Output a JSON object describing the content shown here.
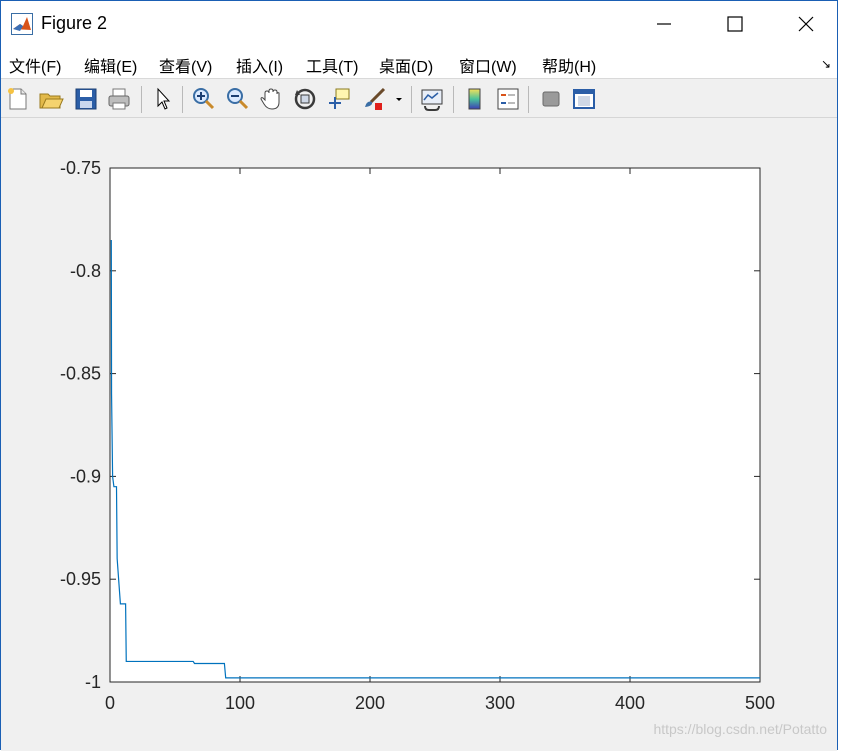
{
  "window": {
    "title": "Figure 2",
    "app_icon": "matlab-logo-icon",
    "controls": [
      "minimize-icon",
      "maximize-icon",
      "close-icon"
    ]
  },
  "menubar": {
    "items": [
      {
        "label": "文件(F)"
      },
      {
        "label": "编辑(E)"
      },
      {
        "label": "查看(V)"
      },
      {
        "label": "插入(I)"
      },
      {
        "label": "工具(T)"
      },
      {
        "label": "桌面(D)"
      },
      {
        "label": "窗口(W)"
      },
      {
        "label": "帮助(H)"
      }
    ],
    "dock_icon": "dock-arrow-icon"
  },
  "toolbar": {
    "buttons": [
      "new-figure-icon",
      "open-file-icon",
      "save-icon",
      "print-icon",
      "edit-plot-icon",
      "zoom-in-icon",
      "zoom-out-icon",
      "pan-icon",
      "rotate-3d-icon",
      "data-cursor-icon",
      "brush-icon",
      "brush-dropdown-icon",
      "link-plot-icon",
      "colorbar-icon",
      "legend-icon",
      "hide-plot-tools-icon",
      "show-plot-tools-icon"
    ]
  },
  "chart_data": {
    "type": "line",
    "title": "",
    "xlabel": "",
    "ylabel": "",
    "xlim": [
      0,
      500
    ],
    "ylim": [
      -1,
      -0.75
    ],
    "xticks": [
      0,
      100,
      200,
      300,
      400,
      500
    ],
    "xtick_labels": [
      "0",
      "100",
      "200",
      "300",
      "400",
      "500"
    ],
    "yticks": [
      -0.75,
      -0.8,
      -0.85,
      -0.9,
      -0.95,
      -1
    ],
    "ytick_labels": [
      "-0.75",
      "-0.8",
      "-0.85",
      "-0.9",
      "-0.95",
      "-1"
    ],
    "grid": false,
    "series": [
      {
        "color": "#0072bd",
        "x": [
          1,
          1.2,
          2,
          3,
          4,
          5,
          5.5,
          8,
          9,
          11,
          12,
          12.5,
          14,
          20,
          30,
          50,
          64,
          65,
          75,
          88,
          89,
          90,
          100,
          200,
          300,
          400,
          500
        ],
        "y": [
          -0.785,
          -0.86,
          -0.9,
          -0.905,
          -0.905,
          -0.905,
          -0.94,
          -0.962,
          -0.962,
          -0.962,
          -0.962,
          -0.99,
          -0.99,
          -0.99,
          -0.99,
          -0.99,
          -0.99,
          -0.991,
          -0.991,
          -0.991,
          -0.998,
          -0.998,
          -0.998,
          -0.998,
          -0.998,
          -0.998,
          -0.998
        ]
      }
    ]
  },
  "watermark": "https://blog.csdn.net/Potatto"
}
